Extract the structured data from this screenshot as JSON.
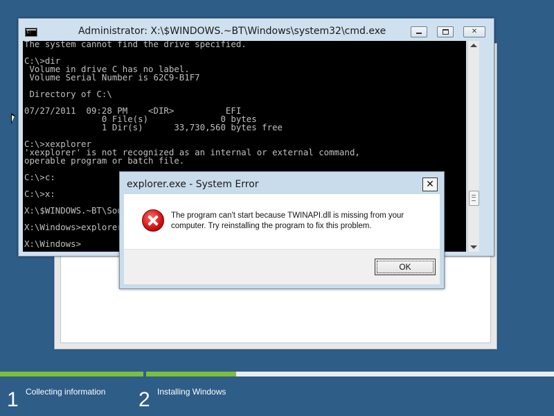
{
  "cmd_window": {
    "title": "Administrator: X:\\$WINDOWS.~BT\\Windows\\system32\\cmd.exe",
    "console_lines": [
      "The system cannot find the drive specified.",
      "",
      "C:\\>dir",
      " Volume in drive C has no label.",
      " Volume Serial Number is 62C9-B1F7",
      "",
      " Directory of C:\\",
      "",
      "07/27/2011  09:28 PM    <DIR>          EFI",
      "               0 File(s)              0 bytes",
      "               1 Dir(s)      33,730,560 bytes free",
      "",
      "C:\\>xexplorer",
      "'xexplorer' is not recognized as an internal or external command,",
      "operable program or batch file.",
      "",
      "C:\\>c:",
      "",
      "C:\\>x:",
      "",
      "X:\\$WINDOWS.~BT\\Sources>x:",
      "",
      "X:\\Windows>explorer",
      "",
      "X:\\Windows>"
    ]
  },
  "error_dialog": {
    "title": "explorer.exe - System Error",
    "message": "The program can't start because TWINAPI.dll is missing from your computer. Try reinstalling the program to fix this problem.",
    "ok_label": "OK",
    "close_label": "✕"
  },
  "setup_progress": {
    "steps": [
      {
        "number": "1",
        "label": "Collecting information",
        "progress": 1.0
      },
      {
        "number": "2",
        "label": "Installing Windows",
        "progress": 0.22
      }
    ],
    "accent_color": "#7bbf3d"
  },
  "colors": {
    "desktop": "#2e5d88",
    "console_bg": "#000000",
    "console_fg": "#c0c0c0",
    "error_red": "#d01010"
  }
}
